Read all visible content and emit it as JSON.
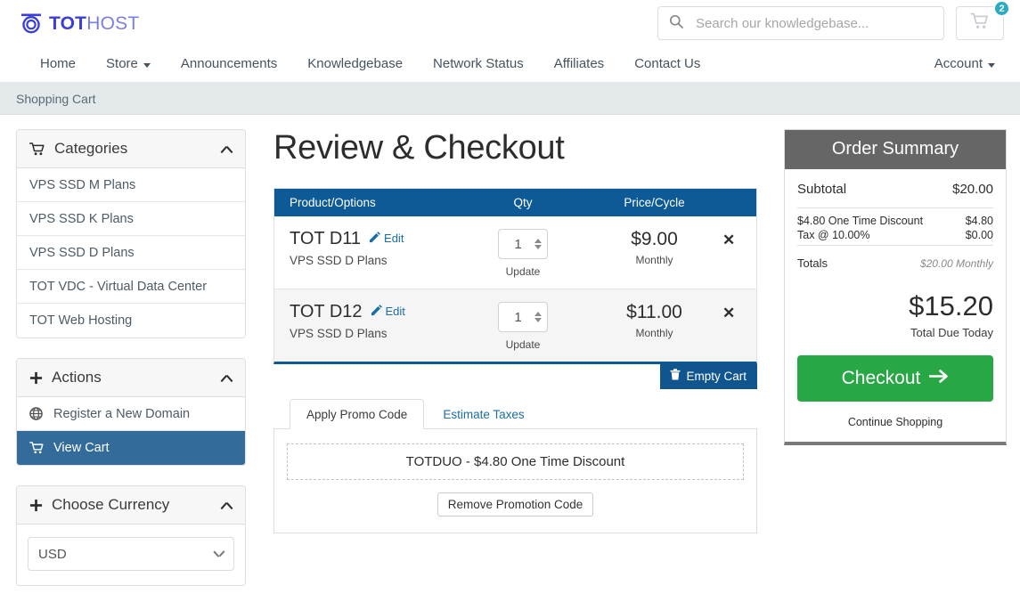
{
  "brand": {
    "logo_primary": "TOT",
    "logo_secondary": "HOST",
    "logo_icon": "tothost-circle-logo",
    "color_primary": "#3b3fd8",
    "color_secondary": "#7b7ee6"
  },
  "search": {
    "placeholder": "Search our knowledgebase...",
    "value": "",
    "icon": "search-icon"
  },
  "cart_button": {
    "icon": "shopping-cart-icon",
    "badge_count": "2",
    "badge_color": "#29abc4"
  },
  "nav": {
    "items": [
      {
        "label": "Home",
        "has_caret": false
      },
      {
        "label": "Store",
        "has_caret": true
      },
      {
        "label": "Announcements",
        "has_caret": false
      },
      {
        "label": "Knowledgebase",
        "has_caret": false
      },
      {
        "label": "Network Status",
        "has_caret": false
      },
      {
        "label": "Affiliates",
        "has_caret": false
      },
      {
        "label": "Contact Us",
        "has_caret": false
      }
    ],
    "account": {
      "label": "Account",
      "has_caret": true
    }
  },
  "breadcrumb": {
    "text": "Shopping Cart"
  },
  "sidebar": {
    "categories_panel": {
      "title": "Categories",
      "icon": "shopping-cart-icon",
      "collapse_icon": "chevron-up-icon",
      "items": [
        {
          "label": "VPS SSD M Plans"
        },
        {
          "label": "VPS SSD K Plans"
        },
        {
          "label": "VPS SSD D Plans"
        },
        {
          "label": "TOT VDC - Virtual Data Center"
        },
        {
          "label": "TOT Web Hosting"
        }
      ]
    },
    "actions_panel": {
      "title": "Actions",
      "icon": "plus-icon",
      "collapse_icon": "chevron-up-icon",
      "items": [
        {
          "label": "Register a New Domain",
          "icon": "globe-icon",
          "active": false
        },
        {
          "label": "View Cart",
          "icon": "shopping-cart-icon",
          "active": true
        }
      ],
      "active_color": "#336c9b"
    },
    "currency_panel": {
      "title": "Choose Currency",
      "icon": "plus-icon",
      "collapse_icon": "chevron-up-icon",
      "selected": "USD",
      "dropdown_icon": "chevron-down-icon"
    }
  },
  "main": {
    "page_title": "Review & Checkout",
    "table": {
      "header_color": "#0d5a96",
      "columns": {
        "product": "Product/Options",
        "qty": "Qty",
        "price": "Price/Cycle"
      },
      "rows": [
        {
          "name": "TOT D11",
          "edit_label": "Edit",
          "edit_icon": "pencil-icon",
          "subtitle": "VPS SSD D Plans",
          "qty": "1",
          "update_label": "Update",
          "price": "$9.00",
          "cycle": "Monthly",
          "remove_icon": "close-icon"
        },
        {
          "name": "TOT D12",
          "edit_label": "Edit",
          "edit_icon": "pencil-icon",
          "subtitle": "VPS SSD D Plans",
          "qty": "1",
          "update_label": "Update",
          "price": "$11.00",
          "cycle": "Monthly",
          "remove_icon": "close-icon"
        }
      ]
    },
    "empty_cart_button": {
      "label": "Empty Cart",
      "icon": "trash-icon"
    },
    "promo": {
      "tabs": [
        {
          "label": "Apply Promo Code",
          "active": true
        },
        {
          "label": "Estimate Taxes",
          "active": false
        }
      ],
      "code_text": "TOTDUO - $4.80 One Time Discount",
      "remove_button": "Remove Promotion Code"
    }
  },
  "summary": {
    "title": "Order Summary",
    "header_color": "#666666",
    "subtotal_label": "Subtotal",
    "subtotal_value": "$20.00",
    "lines": [
      {
        "label": "$4.80 One Time Discount",
        "value": "$4.80"
      },
      {
        "label": "Tax @ 10.00%",
        "value": "$0.00"
      }
    ],
    "totals_label": "Totals",
    "totals_value": "$20.00 Monthly",
    "due_amount": "$15.20",
    "due_label": "Total Due Today",
    "checkout_label": "Checkout",
    "checkout_icon": "arrow-right-icon",
    "checkout_color": "#28a745",
    "continue_label": "Continue Shopping"
  }
}
